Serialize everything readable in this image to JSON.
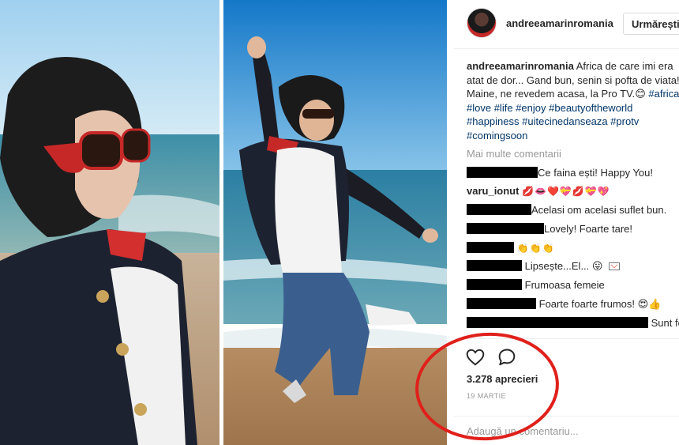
{
  "header": {
    "username": "andreeamarinromania",
    "follow_label": "Urmărești"
  },
  "caption": {
    "username": "andreeamarinromania",
    "text": " Africa de care imi era atat de dor... Gand bun, senin si pofta de viata! Maine, ne revedem acasa, la Pro TV.",
    "emoji": "😊",
    "hashtags": [
      "#africa",
      "#love",
      "#life",
      "#enjoy",
      "#beautyoftheworld",
      "#happiness",
      "#uitecinedanseaza",
      "#protv",
      "#comingsoon"
    ]
  },
  "load_more": "Mai multe comentarii",
  "comments": [
    {
      "user": "",
      "text": "Ce faina ești! Happy You!"
    },
    {
      "user": "varu_ionut",
      "text": "💋👄❤️💝💋💝💖"
    },
    {
      "user": "",
      "text": "Acelasi om acelasi suflet bun."
    },
    {
      "user": "",
      "text": "Lovely! Foarte tare!"
    },
    {
      "user": "",
      "text": "👏👏👏"
    },
    {
      "user": "",
      "text": "Lipsește...El... 😛"
    },
    {
      "user": "",
      "text": "Frumoasa femeie"
    },
    {
      "user": "",
      "text": "Foarte foarte frumos! 😍👍"
    },
    {
      "user": "",
      "text": "Sunt foarte bine si nu imi lipseste nimic"
    }
  ],
  "stats": {
    "likes": "3.278 aprecieri",
    "date": "19 MARTIE"
  },
  "comment_input": {
    "placeholder": "Adaugă un comentariu..."
  },
  "colors": {
    "link": "#003569",
    "muted": "#999999",
    "annotation": "#e0201b"
  },
  "icons": {
    "like": "heart-outline-icon",
    "comment": "speech-bubble-icon"
  }
}
